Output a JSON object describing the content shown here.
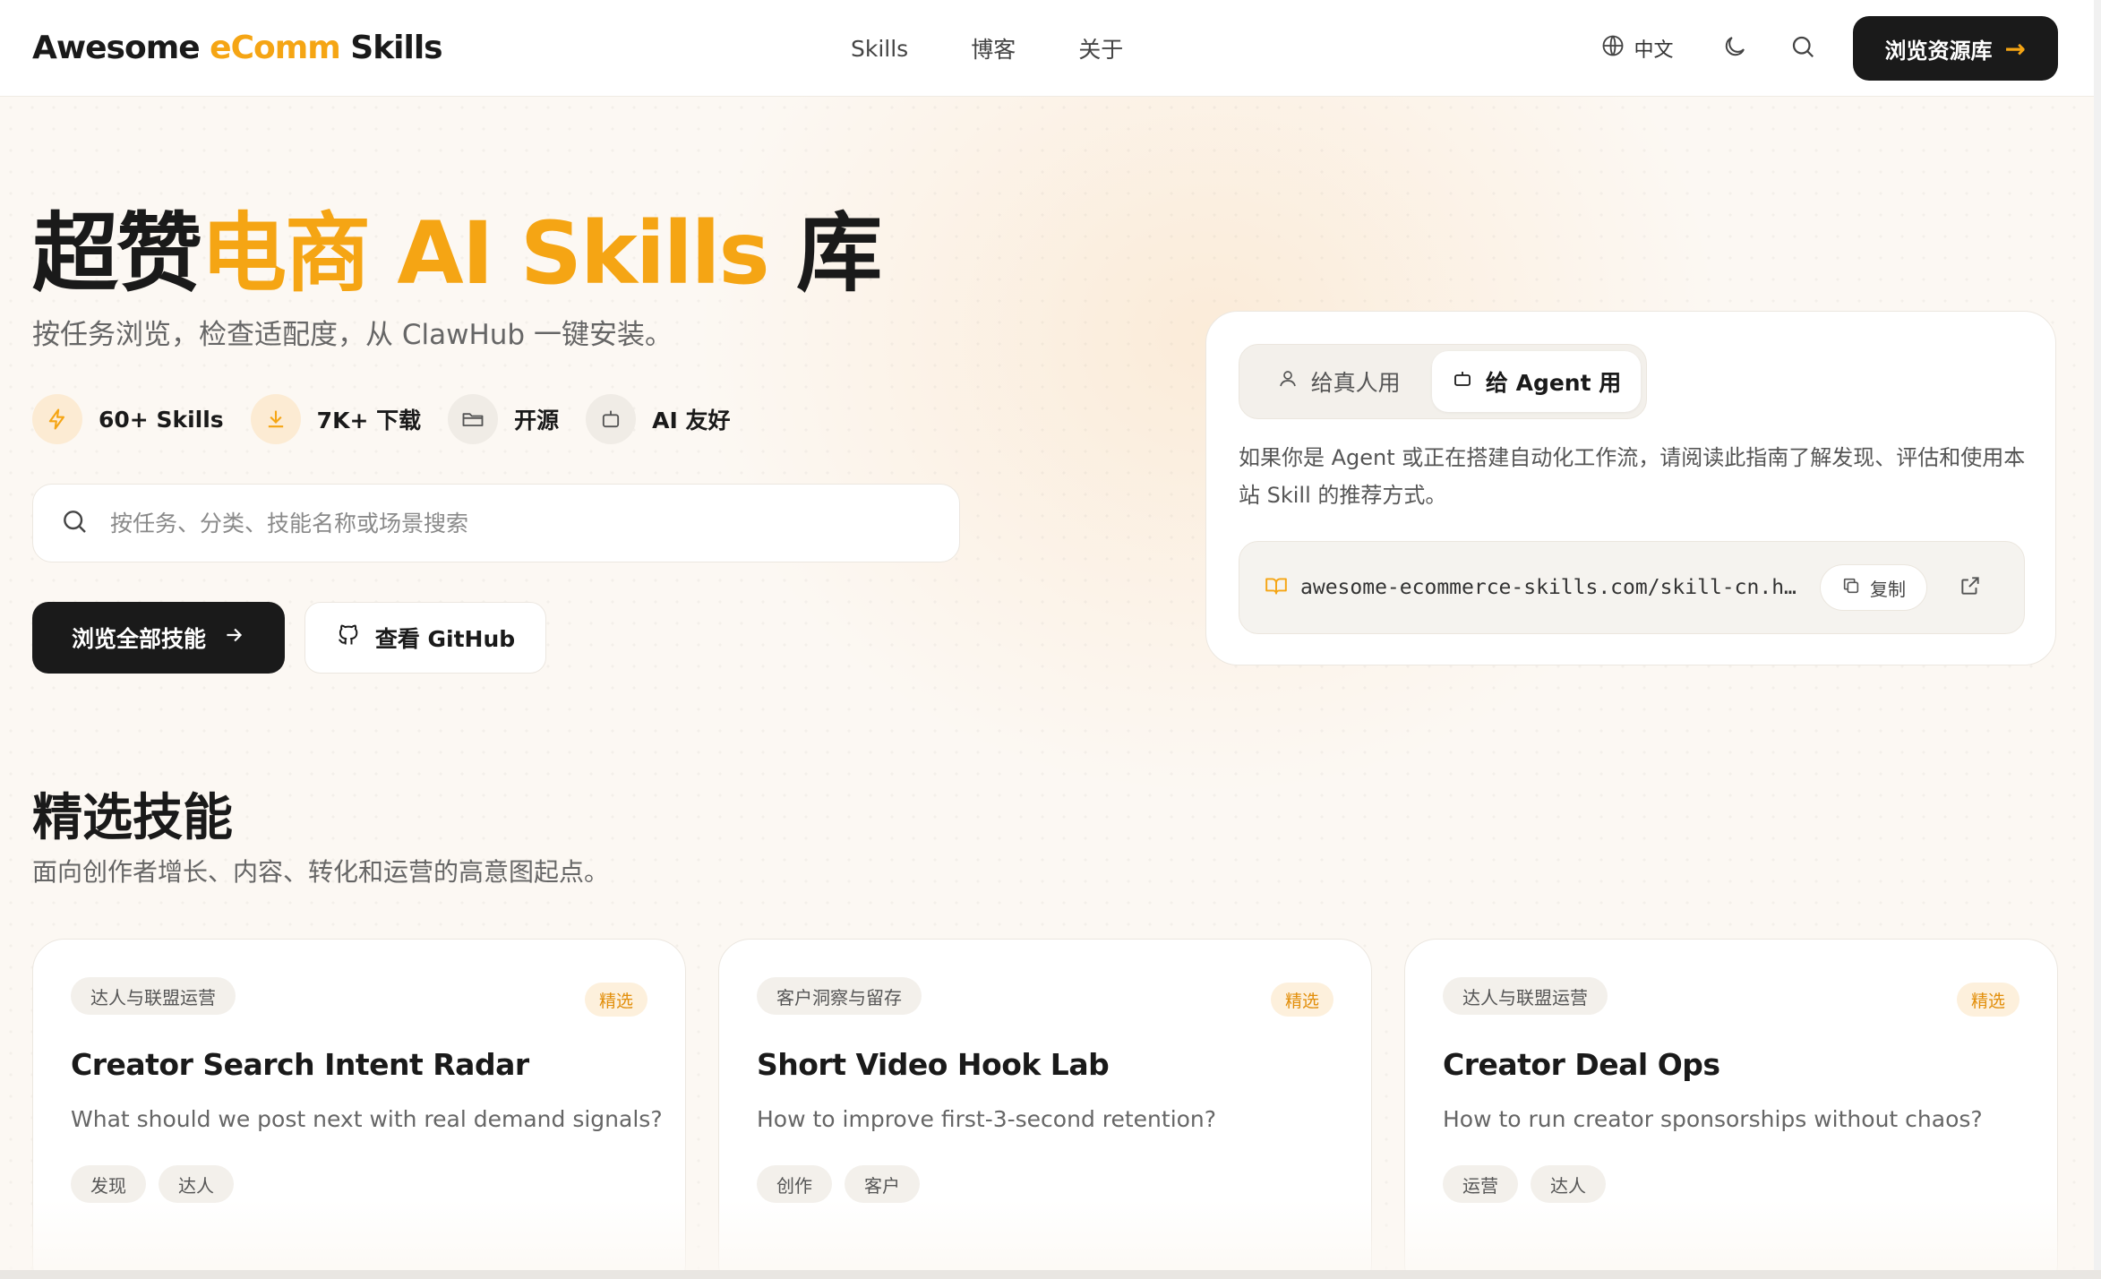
{
  "header": {
    "logo_prefix": "Awesome ",
    "logo_accent": "eComm",
    "logo_suffix": " Skills",
    "nav": [
      "Skills",
      "博客",
      "关于"
    ],
    "language": "中文",
    "cta_label": "浏览资源库",
    "cta_arrow": "→",
    "accent_color": "#f5a514"
  },
  "hero": {
    "title_prefix": "超赞",
    "title_accent": "电商 AI Skills",
    "title_suffix": " 库",
    "subtitle": "按任务浏览，检查适配度，从 ClawHub 一键安装。",
    "stats": [
      {
        "icon": "lightning-icon",
        "label": "60+ Skills"
      },
      {
        "icon": "download-icon",
        "label": "7K+ 下载"
      },
      {
        "icon": "folder-open-icon",
        "label": "开源"
      },
      {
        "icon": "robot-icon",
        "label": "AI 友好"
      }
    ],
    "search_placeholder": "按任务、分类、技能名称或场景搜索",
    "primary_button": "浏览全部技能",
    "secondary_button": "查看 GitHub"
  },
  "agent_panel": {
    "tab_human": "给真人用",
    "tab_agent": "给 Agent 用",
    "active_tab": "给 Agent 用",
    "description": "如果你是 Agent 或正在搭建自动化工作流，请阅读此指南了解发现、评估和使用本站 Skill 的推荐方式。",
    "url": "awesome-ecommerce-skills.com/skill-cn.h…",
    "copy_label": "复制"
  },
  "featured": {
    "title": "精选技能",
    "subtitle": "面向创作者增长、内容、转化和运营的高意图起点。",
    "cards": [
      {
        "category": "达人与联盟运营",
        "badge": "精选",
        "title": "Creator Search Intent Radar",
        "description": "What should we post next with real demand signals?",
        "tags": [
          "发现",
          "达人"
        ]
      },
      {
        "category": "客户洞察与留存",
        "badge": "精选",
        "title": "Short Video Hook Lab",
        "description": "How to improve first-3-second retention?",
        "tags": [
          "创作",
          "客户"
        ]
      },
      {
        "category": "达人与联盟运营",
        "badge": "精选",
        "title": "Creator Deal Ops",
        "description": "How to run creator sponsorships without chaos?",
        "tags": [
          "运营",
          "达人"
        ]
      }
    ]
  }
}
